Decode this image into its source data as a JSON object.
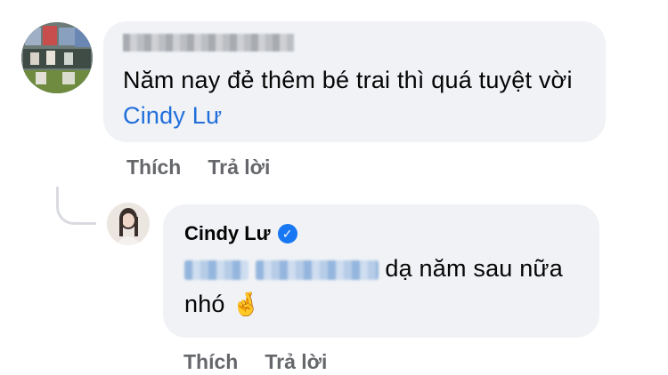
{
  "comment1": {
    "author_blurred": true,
    "text": "Năm nay đẻ thêm bé trai thì quá tuyệt vời",
    "mention": "Cindy Lư",
    "actions": {
      "like": "Thích",
      "reply": "Trả lời"
    }
  },
  "reply1": {
    "author": "Cindy Lư",
    "verified_icon": "verified-badge-icon",
    "text_after_blur": "dạ năm sau nữa nhó",
    "emoji": "🤞",
    "actions": {
      "like": "Thích",
      "reply": "Trả lời"
    }
  },
  "colors": {
    "bubble": "#f0f2f5",
    "mention": "#216fdb",
    "action": "#65676b",
    "verified": "#1877f2"
  }
}
